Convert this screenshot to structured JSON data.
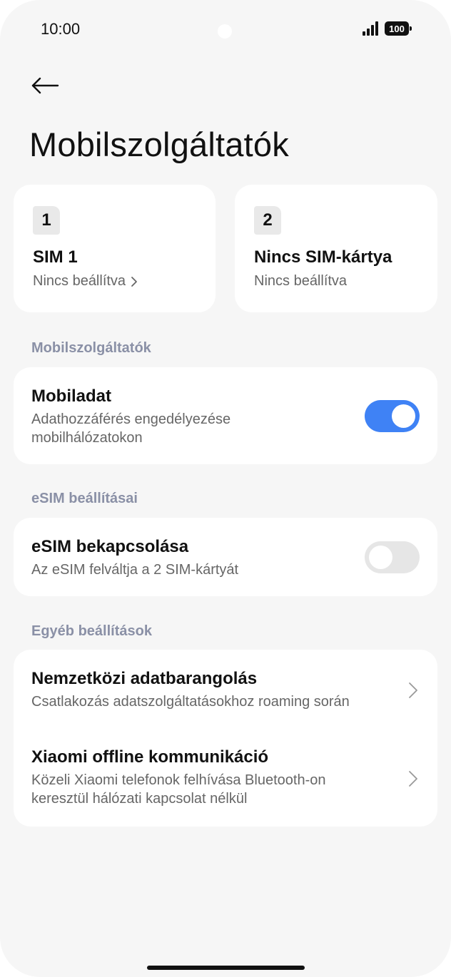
{
  "status_bar": {
    "time": "10:00",
    "battery": "100"
  },
  "page": {
    "title": "Mobilszolgáltatók"
  },
  "sim_cards": [
    {
      "number": "1",
      "name": "SIM 1",
      "status": "Nincs beállítva"
    },
    {
      "number": "2",
      "name": "Nincs SIM-kártya",
      "status": "Nincs beállítva"
    }
  ],
  "sections": {
    "mobile": {
      "header": "Mobilszolgáltatók",
      "mobile_data": {
        "title": "Mobiladat",
        "subtitle_line1": "Adathozzáférés engedélyezése",
        "subtitle_line2": "mobilhálózatokon",
        "enabled": true
      }
    },
    "esim": {
      "header": "eSIM beállításai",
      "esim_toggle": {
        "title": "eSIM bekapcsolása",
        "subtitle": "Az eSIM felváltja a 2 SIM-kártyát",
        "enabled": false
      }
    },
    "other": {
      "header": "Egyéb beállítások",
      "roaming": {
        "title": "Nemzetközi adatbarangolás",
        "subtitle": "Csatlakozás adatszolgáltatásokhoz roaming során"
      },
      "offline": {
        "title": "Xiaomi offline kommunikáció",
        "subtitle_line1": "Közeli Xiaomi telefonok felhívása Bluetooth-on",
        "subtitle_line2": "keresztül hálózati kapcsolat nélkül"
      }
    }
  },
  "colors": {
    "accent": "#3f82f5",
    "section_header": "#8a90a6",
    "background": "#f6f6f6"
  },
  "icons": {
    "back": "arrow-left-icon",
    "chevron": "chevron-right-icon",
    "signal": "signal-icon",
    "battery": "battery-icon"
  }
}
